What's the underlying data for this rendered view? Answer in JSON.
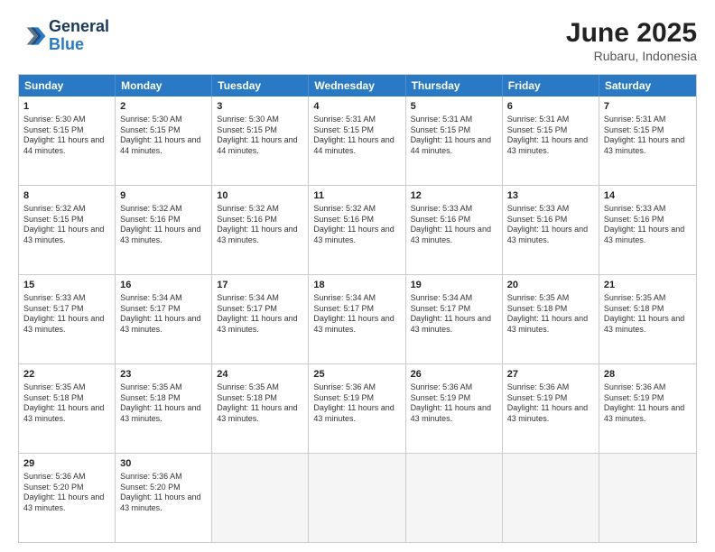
{
  "header": {
    "logo_line1": "General",
    "logo_line2": "Blue",
    "month": "June 2025",
    "location": "Rubaru, Indonesia"
  },
  "days_of_week": [
    "Sunday",
    "Monday",
    "Tuesday",
    "Wednesday",
    "Thursday",
    "Friday",
    "Saturday"
  ],
  "rows": [
    [
      {
        "day": "1",
        "sunrise": "5:30 AM",
        "sunset": "5:15 PM",
        "daylight": "11 hours and 44 minutes."
      },
      {
        "day": "2",
        "sunrise": "5:30 AM",
        "sunset": "5:15 PM",
        "daylight": "11 hours and 44 minutes."
      },
      {
        "day": "3",
        "sunrise": "5:30 AM",
        "sunset": "5:15 PM",
        "daylight": "11 hours and 44 minutes."
      },
      {
        "day": "4",
        "sunrise": "5:31 AM",
        "sunset": "5:15 PM",
        "daylight": "11 hours and 44 minutes."
      },
      {
        "day": "5",
        "sunrise": "5:31 AM",
        "sunset": "5:15 PM",
        "daylight": "11 hours and 44 minutes."
      },
      {
        "day": "6",
        "sunrise": "5:31 AM",
        "sunset": "5:15 PM",
        "daylight": "11 hours and 43 minutes."
      },
      {
        "day": "7",
        "sunrise": "5:31 AM",
        "sunset": "5:15 PM",
        "daylight": "11 hours and 43 minutes."
      }
    ],
    [
      {
        "day": "8",
        "sunrise": "5:32 AM",
        "sunset": "5:15 PM",
        "daylight": "11 hours and 43 minutes."
      },
      {
        "day": "9",
        "sunrise": "5:32 AM",
        "sunset": "5:16 PM",
        "daylight": "11 hours and 43 minutes."
      },
      {
        "day": "10",
        "sunrise": "5:32 AM",
        "sunset": "5:16 PM",
        "daylight": "11 hours and 43 minutes."
      },
      {
        "day": "11",
        "sunrise": "5:32 AM",
        "sunset": "5:16 PM",
        "daylight": "11 hours and 43 minutes."
      },
      {
        "day": "12",
        "sunrise": "5:33 AM",
        "sunset": "5:16 PM",
        "daylight": "11 hours and 43 minutes."
      },
      {
        "day": "13",
        "sunrise": "5:33 AM",
        "sunset": "5:16 PM",
        "daylight": "11 hours and 43 minutes."
      },
      {
        "day": "14",
        "sunrise": "5:33 AM",
        "sunset": "5:16 PM",
        "daylight": "11 hours and 43 minutes."
      }
    ],
    [
      {
        "day": "15",
        "sunrise": "5:33 AM",
        "sunset": "5:17 PM",
        "daylight": "11 hours and 43 minutes."
      },
      {
        "day": "16",
        "sunrise": "5:34 AM",
        "sunset": "5:17 PM",
        "daylight": "11 hours and 43 minutes."
      },
      {
        "day": "17",
        "sunrise": "5:34 AM",
        "sunset": "5:17 PM",
        "daylight": "11 hours and 43 minutes."
      },
      {
        "day": "18",
        "sunrise": "5:34 AM",
        "sunset": "5:17 PM",
        "daylight": "11 hours and 43 minutes."
      },
      {
        "day": "19",
        "sunrise": "5:34 AM",
        "sunset": "5:17 PM",
        "daylight": "11 hours and 43 minutes."
      },
      {
        "day": "20",
        "sunrise": "5:35 AM",
        "sunset": "5:18 PM",
        "daylight": "11 hours and 43 minutes."
      },
      {
        "day": "21",
        "sunrise": "5:35 AM",
        "sunset": "5:18 PM",
        "daylight": "11 hours and 43 minutes."
      }
    ],
    [
      {
        "day": "22",
        "sunrise": "5:35 AM",
        "sunset": "5:18 PM",
        "daylight": "11 hours and 43 minutes."
      },
      {
        "day": "23",
        "sunrise": "5:35 AM",
        "sunset": "5:18 PM",
        "daylight": "11 hours and 43 minutes."
      },
      {
        "day": "24",
        "sunrise": "5:35 AM",
        "sunset": "5:18 PM",
        "daylight": "11 hours and 43 minutes."
      },
      {
        "day": "25",
        "sunrise": "5:36 AM",
        "sunset": "5:19 PM",
        "daylight": "11 hours and 43 minutes."
      },
      {
        "day": "26",
        "sunrise": "5:36 AM",
        "sunset": "5:19 PM",
        "daylight": "11 hours and 43 minutes."
      },
      {
        "day": "27",
        "sunrise": "5:36 AM",
        "sunset": "5:19 PM",
        "daylight": "11 hours and 43 minutes."
      },
      {
        "day": "28",
        "sunrise": "5:36 AM",
        "sunset": "5:19 PM",
        "daylight": "11 hours and 43 minutes."
      }
    ],
    [
      {
        "day": "29",
        "sunrise": "5:36 AM",
        "sunset": "5:20 PM",
        "daylight": "11 hours and 43 minutes."
      },
      {
        "day": "30",
        "sunrise": "5:36 AM",
        "sunset": "5:20 PM",
        "daylight": "11 hours and 43 minutes."
      },
      null,
      null,
      null,
      null,
      null
    ]
  ]
}
